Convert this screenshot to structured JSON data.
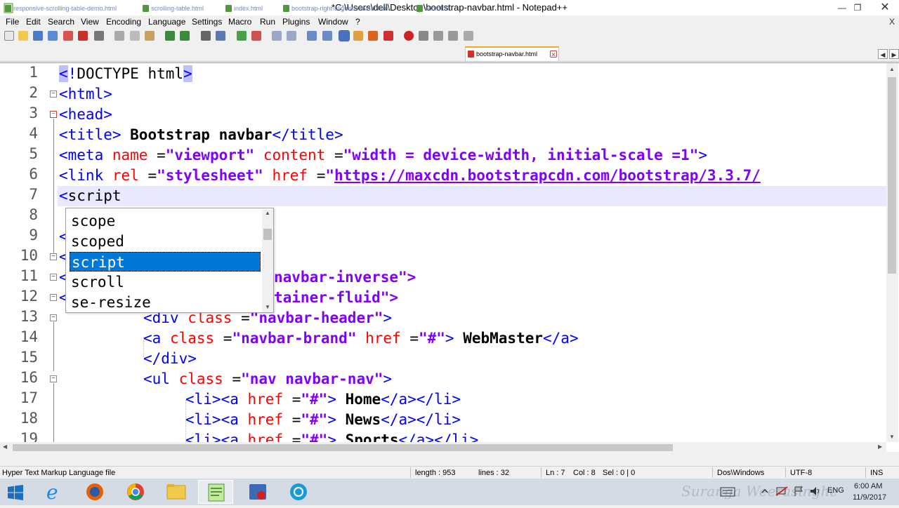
{
  "window": {
    "title": "*C:\\Users\\dell\\Desktop\\bootstrap-navbar.html - Notepad++",
    "min": "—",
    "max": "❐",
    "close": "✕"
  },
  "menu": [
    "File",
    "Edit",
    "Search",
    "View",
    "Encoding",
    "Language",
    "Settings",
    "Macro",
    "Run",
    "Plugins",
    "Window",
    "?"
  ],
  "menu_close": "X",
  "tabs": [
    {
      "label": "responsive-scrolling-table-demo.html",
      "active": false
    },
    {
      "label": "scrolling-table.html",
      "active": false
    },
    {
      "label": "index.html",
      "active": false
    },
    {
      "label": "bootstrap-right-aligned-navbar.html",
      "active": false
    },
    {
      "label": "cdn.html",
      "active": false
    },
    {
      "label": "bootstrap-navbar.html",
      "active": true
    }
  ],
  "tab_scroll": {
    "left": "◀",
    "right": "▶"
  },
  "editor": {
    "line_numbers": [
      "1",
      "2",
      "3",
      "4",
      "5",
      "6",
      "7",
      "8",
      "9",
      "10",
      "11",
      "12",
      "13",
      "14",
      "15",
      "16",
      "17",
      "18",
      "19"
    ],
    "line1": {
      "open": "<",
      "bang": "!",
      "doctype": "DOCTYPE html",
      "close": ">"
    },
    "line2": "<html>",
    "line3": "<head>",
    "line4": {
      "open": "<title>",
      "text": " Bootstrap navbar",
      "close": "</title>"
    },
    "line5": {
      "tag": "<meta ",
      "a1": "name ",
      "eq1": "=",
      "v1": "\"viewport\" ",
      "a2": "content ",
      "eq2": "=",
      "v2": "\"width = device-width, initial-scale =1\"",
      "end": ">"
    },
    "line6": {
      "tag": "<link ",
      "a1": "rel ",
      "eq1": "=",
      "v1": "\"stylesheet\" ",
      "a2": "href ",
      "eq2": "=",
      "q": "\"",
      "url": "https://maxcdn.bootstrapcdn.com/bootstrap/3.3.7/"
    },
    "line7": {
      "lt": "<",
      "text": "script"
    },
    "line9": "<",
    "line10": "<",
    "line11": {
      "lt": "<",
      "tail": "navbar-inverse\">"
    },
    "line12": {
      "lt": "<",
      "tail": "tainer-fluid\">"
    },
    "line13": {
      "tag": "<div ",
      "a1": "class ",
      "eq": "=",
      "v": "\"navbar-header\"",
      "end": ">"
    },
    "line14": {
      "tag": "<a ",
      "a1": "class ",
      "eq1": "=",
      "v1": "\"navbar-brand\" ",
      "a2": "href ",
      "eq2": "=",
      "v2": "\"#\"",
      "gt": ">",
      "text": " WebMaster",
      "close": "</a>"
    },
    "line15": "</div>",
    "line16": {
      "tag": "<ul ",
      "a1": "class ",
      "eq": "=",
      "v": "\"nav navbar-nav\"",
      "end": ">"
    },
    "line17": {
      "tag": "<li><a ",
      "a1": "href ",
      "eq": "=",
      "v": "\"#\"",
      "gt": ">",
      "text": " Home",
      "close": "</a></li>"
    },
    "line18": {
      "tag": "<li><a ",
      "a1": "href ",
      "eq": "=",
      "v": "\"#\"",
      "gt": ">",
      "text": " News",
      "close": "</a></li>"
    },
    "line19": {
      "tag": "<li><a ",
      "a1": "href ",
      "eq": "=",
      "v": "\"#\"",
      "gt": ">",
      "text": " Sports",
      "close": "</a></li>"
    }
  },
  "autocomplete": {
    "items": [
      "scope",
      "scoped",
      "script",
      "scroll",
      "se-resize"
    ],
    "selected_index": 2
  },
  "status": {
    "file_type": "Hyper Text Markup Language file",
    "length": "length : 953",
    "lines": "lines : 32",
    "ln": "Ln : 7",
    "col": "Col : 8",
    "sel": "Sel : 0 | 0",
    "eol": "Dos\\Windows",
    "encoding": "UTF-8",
    "mode": "INS"
  },
  "taskbar": {
    "lang": "ENG",
    "time": "6:00 AM",
    "date": "11/9/2017",
    "watermark": "Suranga Weerasinghe"
  },
  "colors": {
    "tag": "#0000ff",
    "attr": "#ff0000",
    "value": "#8000ff",
    "selection": "#0078d7",
    "active_tab_accent": "#f5a623"
  }
}
